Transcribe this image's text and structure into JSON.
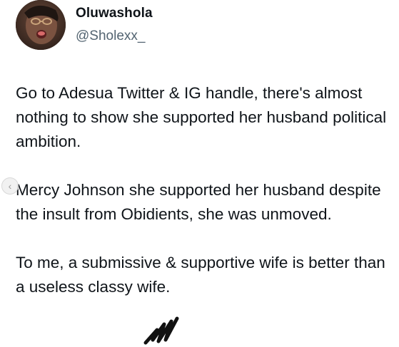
{
  "tweet": {
    "author": {
      "name": "Oluwashola",
      "handle": "@Sholexx_"
    },
    "paragraphs": [
      "Go to Adesua Twitter & IG handle, there's almost nothing to show she supported her husband political ambition.",
      "Mercy Johnson she supported her husband despite the insult from Obidients, she was unmoved.",
      "To me, a submissive & supportive wife is better than a useless classy wife."
    ]
  },
  "icons": {
    "nav": "chevron-left-icon",
    "avatar": "profile-photo"
  }
}
